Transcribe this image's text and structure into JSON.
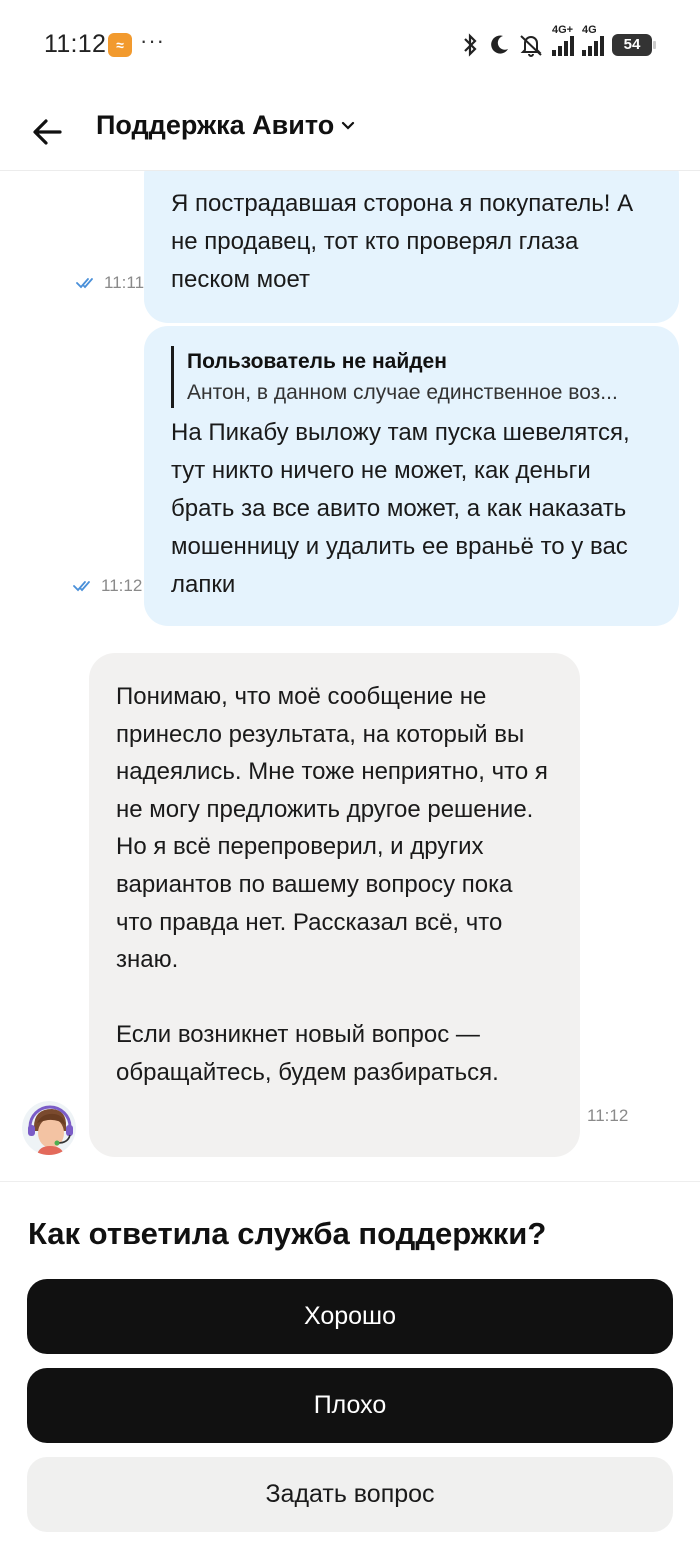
{
  "status_bar": {
    "time": "11:12",
    "app_badge": "≈",
    "more": "···",
    "network_1": "4G+",
    "network_2": "4G",
    "battery": "54"
  },
  "header": {
    "title": "Поддержка Авито"
  },
  "messages": [
    {
      "direction": "outgoing",
      "time": "11:11",
      "text": "Я пострадавшая сторона я покупатель! А не продавец, тот кто проверял глаза песком моет"
    },
    {
      "direction": "outgoing",
      "time": "11:12",
      "quote_title": "Пользователь не найден",
      "quote_text": "Антон, в данном случае единственное воз...",
      "text": "На Пикабу выложу там пуска шевелятся, тут никто ничего не может, как деньги брать за все авито может, а как наказать мошенницу и удалить ее враньё то у вас лапки"
    },
    {
      "direction": "incoming",
      "time": "11:12",
      "paragraph_1": "Понимаю, что моё сообщение не принесло результата, на который вы надеялись. Мне тоже неприятно, что я не могу предложить другое решение. Но я всё перепроверил, и других вариантов по вашему вопросу пока что правда нет. Рассказал всё, что знаю.",
      "paragraph_2": "Если возникнет новый вопрос — обращайтесь, будем разбираться."
    }
  ],
  "rating": {
    "question": "Как ответила служба поддержки?",
    "good_label": "Хорошо",
    "bad_label": "Плохо",
    "ask_label": "Задать вопрос"
  },
  "colors": {
    "outgoing_bubble": "#e5f3fd",
    "incoming_bubble": "#f2f1f0",
    "dark_button": "#111111",
    "light_button": "#f0f0ef",
    "read_ticks": "#4a90d9"
  }
}
